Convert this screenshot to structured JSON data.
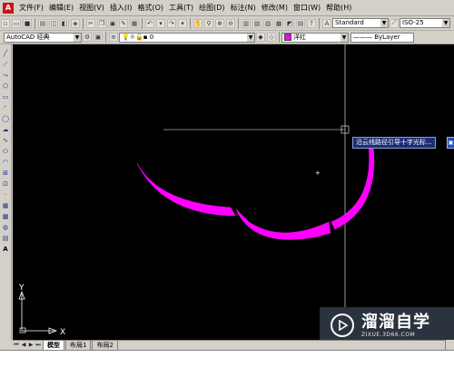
{
  "menu": {
    "items": [
      "文件(F)",
      "编辑(E)",
      "视图(V)",
      "插入(I)",
      "格式(O)",
      "工具(T)",
      "绘图(D)",
      "标注(N)",
      "修改(M)",
      "窗口(W)",
      "帮助(H)"
    ]
  },
  "toolbar1": {
    "text_style": "Standard",
    "dim_style": "ISO-25"
  },
  "toolbar2": {
    "workspace": "AutoCAD 经典",
    "layer": "0",
    "color": "洋红",
    "linetype": "ByLayer"
  },
  "canvas": {
    "tooltip": "沿云线路径引导十字光标...",
    "ucs_x": "X",
    "ucs_y": "Y",
    "stroke_color": "#ff00ff",
    "background_color": "#000000"
  },
  "tabs": [
    "模型",
    "布局1",
    "布局2"
  ],
  "watermark": {
    "name": "溜溜自学",
    "url": "ZIXUE.3D66.COM"
  }
}
